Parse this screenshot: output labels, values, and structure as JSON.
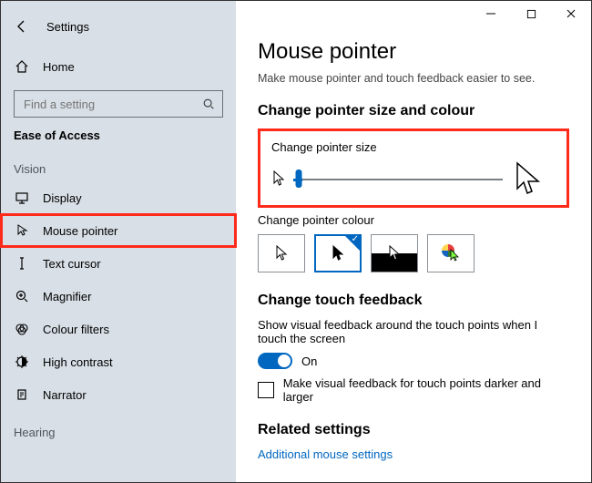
{
  "window": {
    "app": "Settings",
    "search_placeholder": "Find a setting",
    "section": "Ease of Access"
  },
  "sidebar": {
    "home": "Home",
    "group_vision": "Vision",
    "group_hearing": "Hearing",
    "items": [
      {
        "label": "Display"
      },
      {
        "label": "Mouse pointer"
      },
      {
        "label": "Text cursor"
      },
      {
        "label": "Magnifier"
      },
      {
        "label": "Colour filters"
      },
      {
        "label": "High contrast"
      },
      {
        "label": "Narrator"
      }
    ]
  },
  "main": {
    "title": "Mouse pointer",
    "subtitle": "Make mouse pointer and touch feedback easier to see.",
    "size_heading": "Change pointer size and colour",
    "size_label": "Change pointer size",
    "colour_label": "Change pointer colour",
    "touch_heading": "Change touch feedback",
    "touch_text": "Show visual feedback around the touch points when I touch the screen",
    "toggle_state": "On",
    "touch_check": "Make visual feedback for touch points darker and larger",
    "related_heading": "Related settings",
    "related_link": "Additional mouse settings"
  }
}
